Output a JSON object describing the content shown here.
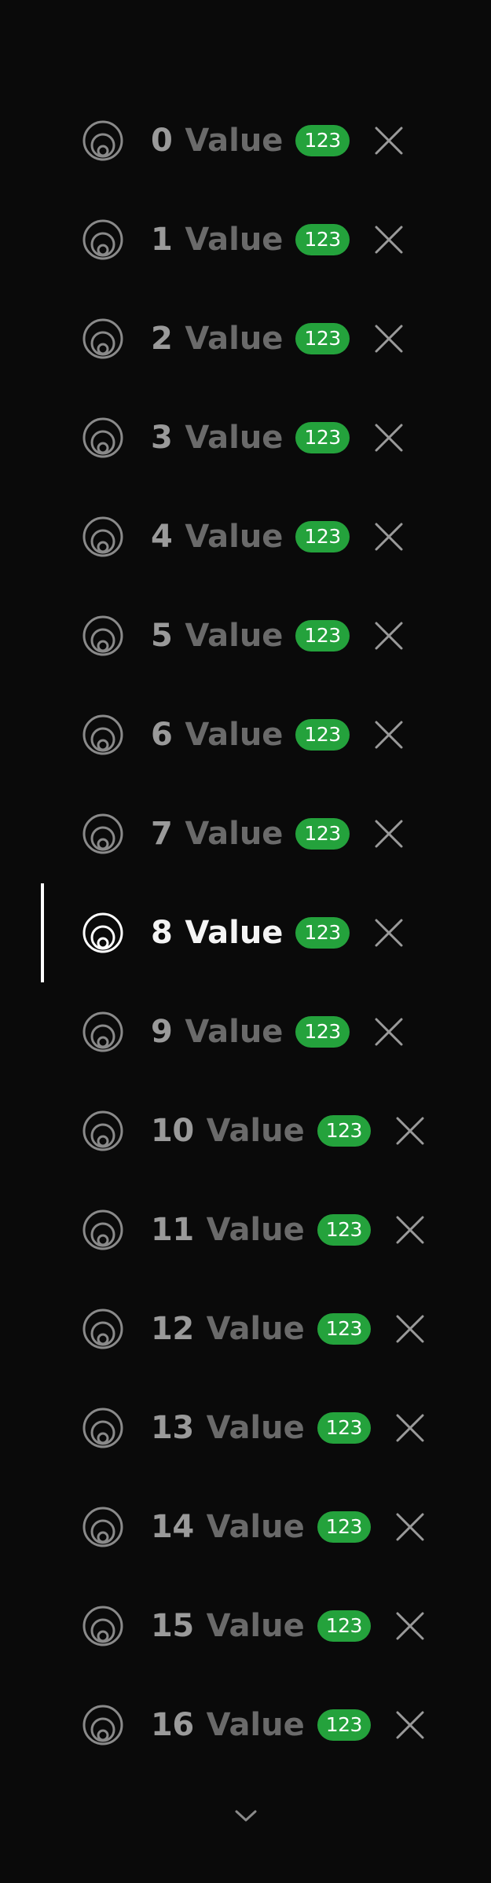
{
  "colors": {
    "background": "#0a0a0a",
    "badge": "#24a23c",
    "active": "#ffffff",
    "inactive_text": "#6a6a6a"
  },
  "list": {
    "active_index": 8,
    "items": [
      {
        "num": "0",
        "label": "Value",
        "badge": "123",
        "icon": "concentric-circles-icon"
      },
      {
        "num": "1",
        "label": "Value",
        "badge": "123",
        "icon": "concentric-circles-icon"
      },
      {
        "num": "2",
        "label": "Value",
        "badge": "123",
        "icon": "concentric-circles-icon"
      },
      {
        "num": "3",
        "label": "Value",
        "badge": "123",
        "icon": "concentric-circles-icon"
      },
      {
        "num": "4",
        "label": "Value",
        "badge": "123",
        "icon": "concentric-circles-icon"
      },
      {
        "num": "5",
        "label": "Value",
        "badge": "123",
        "icon": "concentric-circles-icon"
      },
      {
        "num": "6",
        "label": "Value",
        "badge": "123",
        "icon": "concentric-circles-icon"
      },
      {
        "num": "7",
        "label": "Value",
        "badge": "123",
        "icon": "concentric-circles-icon"
      },
      {
        "num": "8",
        "label": "Value",
        "badge": "123",
        "icon": "concentric-circles-icon"
      },
      {
        "num": "9",
        "label": "Value",
        "badge": "123",
        "icon": "concentric-circles-icon"
      },
      {
        "num": "10",
        "label": "Value",
        "badge": "123",
        "icon": "concentric-circles-icon"
      },
      {
        "num": "11",
        "label": "Value",
        "badge": "123",
        "icon": "concentric-circles-icon"
      },
      {
        "num": "12",
        "label": "Value",
        "badge": "123",
        "icon": "concentric-circles-icon"
      },
      {
        "num": "13",
        "label": "Value",
        "badge": "123",
        "icon": "concentric-circles-icon"
      },
      {
        "num": "14",
        "label": "Value",
        "badge": "123",
        "icon": "concentric-circles-icon"
      },
      {
        "num": "15",
        "label": "Value",
        "badge": "123",
        "icon": "concentric-circles-icon"
      },
      {
        "num": "16",
        "label": "Value",
        "badge": "123",
        "icon": "concentric-circles-icon"
      }
    ]
  },
  "footer": {
    "more_icon": "chevron-down-icon"
  }
}
